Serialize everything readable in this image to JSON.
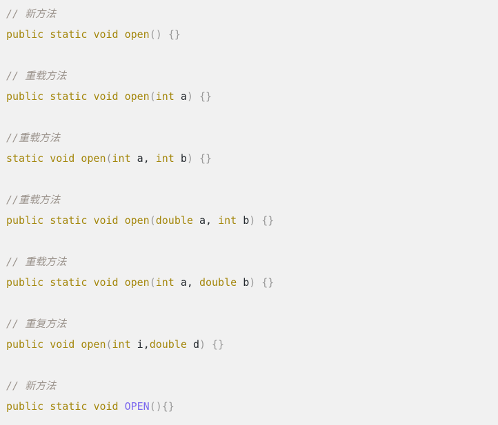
{
  "editor": {
    "background_color": "#f1f1f1",
    "language": "java",
    "colors": {
      "comment": "#9b938c",
      "keyword": "#a4870c",
      "type": "#a4870c",
      "method": "#a4870c",
      "static_method": "#7b68ee",
      "identifier": "#24292e",
      "punctuation": "#9a9a9a"
    }
  },
  "lines": [
    {
      "id": "line-1-comment",
      "kind": "comment",
      "text": "// 新方法",
      "tokens": [
        {
          "t": "// 新方法",
          "c": "tok-comment"
        }
      ]
    },
    {
      "id": "line-2-code",
      "kind": "code",
      "text": "public static void open() {}",
      "tokens": [
        {
          "t": "public",
          "c": "tok-keyword"
        },
        {
          "t": " ",
          "c": "tok-plain"
        },
        {
          "t": "static",
          "c": "tok-keyword"
        },
        {
          "t": " ",
          "c": "tok-plain"
        },
        {
          "t": "void",
          "c": "tok-keyword"
        },
        {
          "t": " ",
          "c": "tok-plain"
        },
        {
          "t": "open",
          "c": "tok-fn"
        },
        {
          "t": "()",
          "c": "tok-punct"
        },
        {
          "t": " ",
          "c": "tok-plain"
        },
        {
          "t": "{}",
          "c": "tok-punct"
        }
      ]
    },
    {
      "id": "blank-1",
      "kind": "blank",
      "text": "",
      "tokens": []
    },
    {
      "id": "line-3-comment",
      "kind": "comment",
      "text": "// 重载方法",
      "tokens": [
        {
          "t": "// 重载方法",
          "c": "tok-comment"
        }
      ]
    },
    {
      "id": "line-4-code",
      "kind": "code",
      "text": "public static void open(int a) {}",
      "tokens": [
        {
          "t": "public",
          "c": "tok-keyword"
        },
        {
          "t": " ",
          "c": "tok-plain"
        },
        {
          "t": "static",
          "c": "tok-keyword"
        },
        {
          "t": " ",
          "c": "tok-plain"
        },
        {
          "t": "void",
          "c": "tok-keyword"
        },
        {
          "t": " ",
          "c": "tok-plain"
        },
        {
          "t": "open",
          "c": "tok-fn"
        },
        {
          "t": "(",
          "c": "tok-punct"
        },
        {
          "t": "int",
          "c": "tok-type"
        },
        {
          "t": " ",
          "c": "tok-plain"
        },
        {
          "t": "a",
          "c": "tok-ident"
        },
        {
          "t": ")",
          "c": "tok-punct"
        },
        {
          "t": " ",
          "c": "tok-plain"
        },
        {
          "t": "{}",
          "c": "tok-punct"
        }
      ]
    },
    {
      "id": "blank-2",
      "kind": "blank",
      "text": "",
      "tokens": []
    },
    {
      "id": "line-5-comment",
      "kind": "comment",
      "text": "//重载方法",
      "tokens": [
        {
          "t": "//重载方法",
          "c": "tok-comment"
        }
      ]
    },
    {
      "id": "line-6-code",
      "kind": "code",
      "text": "static void open(int a, int b) {}",
      "tokens": [
        {
          "t": "static",
          "c": "tok-keyword"
        },
        {
          "t": " ",
          "c": "tok-plain"
        },
        {
          "t": "void",
          "c": "tok-keyword"
        },
        {
          "t": " ",
          "c": "tok-plain"
        },
        {
          "t": "open",
          "c": "tok-fn"
        },
        {
          "t": "(",
          "c": "tok-punct"
        },
        {
          "t": "int",
          "c": "tok-type"
        },
        {
          "t": " ",
          "c": "tok-plain"
        },
        {
          "t": "a",
          "c": "tok-ident"
        },
        {
          "t": ",",
          "c": "tok-comma"
        },
        {
          "t": " ",
          "c": "tok-plain"
        },
        {
          "t": "int",
          "c": "tok-type"
        },
        {
          "t": " ",
          "c": "tok-plain"
        },
        {
          "t": "b",
          "c": "tok-ident"
        },
        {
          "t": ")",
          "c": "tok-punct"
        },
        {
          "t": " ",
          "c": "tok-plain"
        },
        {
          "t": "{}",
          "c": "tok-punct"
        }
      ]
    },
    {
      "id": "blank-3",
      "kind": "blank",
      "text": "",
      "tokens": []
    },
    {
      "id": "line-7-comment",
      "kind": "comment",
      "text": "//重载方法",
      "tokens": [
        {
          "t": "//重载方法",
          "c": "tok-comment"
        }
      ]
    },
    {
      "id": "line-8-code",
      "kind": "code",
      "text": "public static void open(double a, int b) {}",
      "tokens": [
        {
          "t": "public",
          "c": "tok-keyword"
        },
        {
          "t": " ",
          "c": "tok-plain"
        },
        {
          "t": "static",
          "c": "tok-keyword"
        },
        {
          "t": " ",
          "c": "tok-plain"
        },
        {
          "t": "void",
          "c": "tok-keyword"
        },
        {
          "t": " ",
          "c": "tok-plain"
        },
        {
          "t": "open",
          "c": "tok-fn"
        },
        {
          "t": "(",
          "c": "tok-punct"
        },
        {
          "t": "double",
          "c": "tok-type"
        },
        {
          "t": " ",
          "c": "tok-plain"
        },
        {
          "t": "a",
          "c": "tok-ident"
        },
        {
          "t": ",",
          "c": "tok-comma"
        },
        {
          "t": " ",
          "c": "tok-plain"
        },
        {
          "t": "int",
          "c": "tok-type"
        },
        {
          "t": " ",
          "c": "tok-plain"
        },
        {
          "t": "b",
          "c": "tok-ident"
        },
        {
          "t": ")",
          "c": "tok-punct"
        },
        {
          "t": " ",
          "c": "tok-plain"
        },
        {
          "t": "{}",
          "c": "tok-punct"
        }
      ]
    },
    {
      "id": "blank-4",
      "kind": "blank",
      "text": "",
      "tokens": []
    },
    {
      "id": "line-9-comment",
      "kind": "comment",
      "text": "// 重载方法",
      "tokens": [
        {
          "t": "// 重载方法",
          "c": "tok-comment"
        }
      ]
    },
    {
      "id": "line-10-code",
      "kind": "code",
      "text": "public static void open(int a, double b) {}",
      "tokens": [
        {
          "t": "public",
          "c": "tok-keyword"
        },
        {
          "t": " ",
          "c": "tok-plain"
        },
        {
          "t": "static",
          "c": "tok-keyword"
        },
        {
          "t": " ",
          "c": "tok-plain"
        },
        {
          "t": "void",
          "c": "tok-keyword"
        },
        {
          "t": " ",
          "c": "tok-plain"
        },
        {
          "t": "open",
          "c": "tok-fn"
        },
        {
          "t": "(",
          "c": "tok-punct"
        },
        {
          "t": "int",
          "c": "tok-type"
        },
        {
          "t": " ",
          "c": "tok-plain"
        },
        {
          "t": "a",
          "c": "tok-ident"
        },
        {
          "t": ",",
          "c": "tok-comma"
        },
        {
          "t": " ",
          "c": "tok-plain"
        },
        {
          "t": "double",
          "c": "tok-type"
        },
        {
          "t": " ",
          "c": "tok-plain"
        },
        {
          "t": "b",
          "c": "tok-ident"
        },
        {
          "t": ")",
          "c": "tok-punct"
        },
        {
          "t": " ",
          "c": "tok-plain"
        },
        {
          "t": "{}",
          "c": "tok-punct"
        }
      ]
    },
    {
      "id": "blank-5",
      "kind": "blank",
      "text": "",
      "tokens": []
    },
    {
      "id": "line-11-comment",
      "kind": "comment",
      "text": "// 重复方法",
      "tokens": [
        {
          "t": "// 重复方法",
          "c": "tok-comment"
        }
      ]
    },
    {
      "id": "line-12-code",
      "kind": "code",
      "text": "public void open(int i,double d) {}",
      "tokens": [
        {
          "t": "public",
          "c": "tok-keyword"
        },
        {
          "t": " ",
          "c": "tok-plain"
        },
        {
          "t": "void",
          "c": "tok-keyword"
        },
        {
          "t": " ",
          "c": "tok-plain"
        },
        {
          "t": "open",
          "c": "tok-fn"
        },
        {
          "t": "(",
          "c": "tok-punct"
        },
        {
          "t": "int",
          "c": "tok-type"
        },
        {
          "t": " ",
          "c": "tok-plain"
        },
        {
          "t": "i",
          "c": "tok-ident"
        },
        {
          "t": ",",
          "c": "tok-comma"
        },
        {
          "t": "double",
          "c": "tok-type"
        },
        {
          "t": " ",
          "c": "tok-plain"
        },
        {
          "t": "d",
          "c": "tok-ident"
        },
        {
          "t": ")",
          "c": "tok-punct"
        },
        {
          "t": " ",
          "c": "tok-plain"
        },
        {
          "t": "{}",
          "c": "tok-punct"
        }
      ]
    },
    {
      "id": "blank-6",
      "kind": "blank",
      "text": "",
      "tokens": []
    },
    {
      "id": "line-13-comment",
      "kind": "comment",
      "text": "// 新方法",
      "tokens": [
        {
          "t": "// 新方法",
          "c": "tok-comment"
        }
      ]
    },
    {
      "id": "line-14-code",
      "kind": "code",
      "text": "public static void OPEN(){}",
      "tokens": [
        {
          "t": "public",
          "c": "tok-keyword"
        },
        {
          "t": " ",
          "c": "tok-plain"
        },
        {
          "t": "static",
          "c": "tok-keyword"
        },
        {
          "t": " ",
          "c": "tok-plain"
        },
        {
          "t": "void",
          "c": "tok-keyword"
        },
        {
          "t": " ",
          "c": "tok-plain"
        },
        {
          "t": "OPEN",
          "c": "tok-fn-static"
        },
        {
          "t": "()",
          "c": "tok-punct"
        },
        {
          "t": "{}",
          "c": "tok-punct"
        }
      ]
    }
  ]
}
